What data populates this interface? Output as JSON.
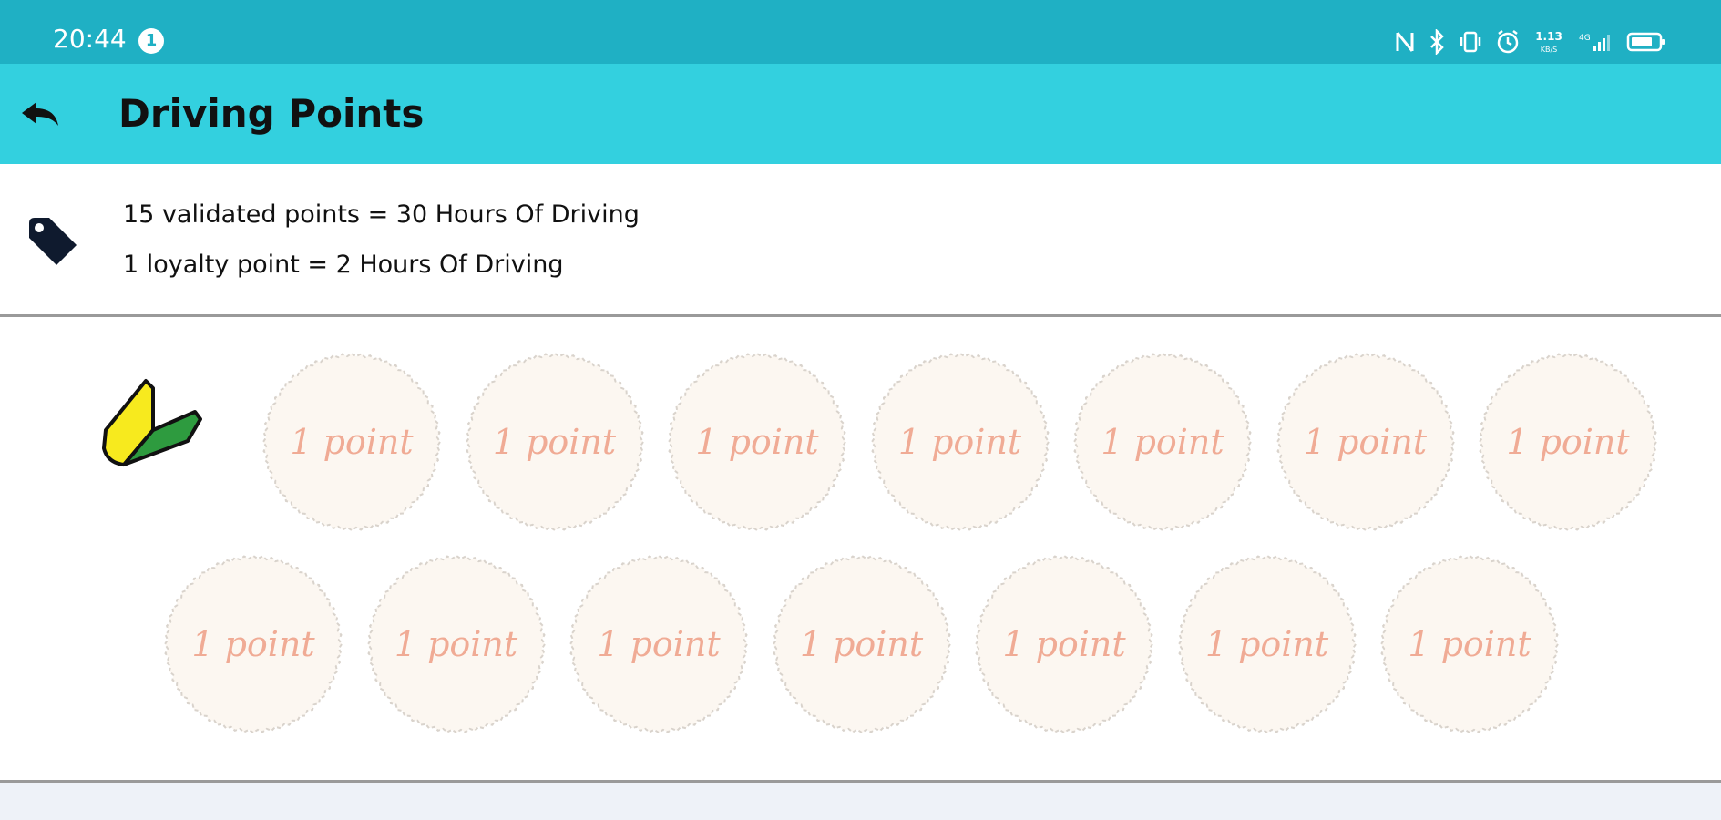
{
  "status_bar": {
    "time": "20:44",
    "notification_count": "1",
    "icons": [
      "nfc-icon",
      "bluetooth-icon",
      "vibrate-icon",
      "alarm-icon",
      "network-speed-icon",
      "signal-icon",
      "battery-icon"
    ],
    "network_speed": "1.13 KB/S"
  },
  "app_bar": {
    "title": "Driving Points",
    "back_icon": "back-arrow-icon"
  },
  "info": {
    "icon": "tag-icon",
    "line1": "15 validated points = 30 Hours Of Driving",
    "line2": "1 loyalty point = 2 Hours Of Driving"
  },
  "card": {
    "badge_icon": "beginner-driver-mark-icon",
    "points": [
      {
        "label": "1 point"
      },
      {
        "label": "1 point"
      },
      {
        "label": "1 point"
      },
      {
        "label": "1 point"
      },
      {
        "label": "1 point"
      },
      {
        "label": "1 point"
      },
      {
        "label": "1 point"
      },
      {
        "label": "1 point"
      },
      {
        "label": "1 point"
      },
      {
        "label": "1 point"
      },
      {
        "label": "1 point"
      },
      {
        "label": "1 point"
      },
      {
        "label": "1 point"
      },
      {
        "label": "1 point"
      }
    ]
  },
  "colors": {
    "status_bar": "#1fb0c4",
    "app_bar": "#33d0df",
    "stamp_fill": "#fcf7f1",
    "stamp_text": "#f0ab95"
  }
}
